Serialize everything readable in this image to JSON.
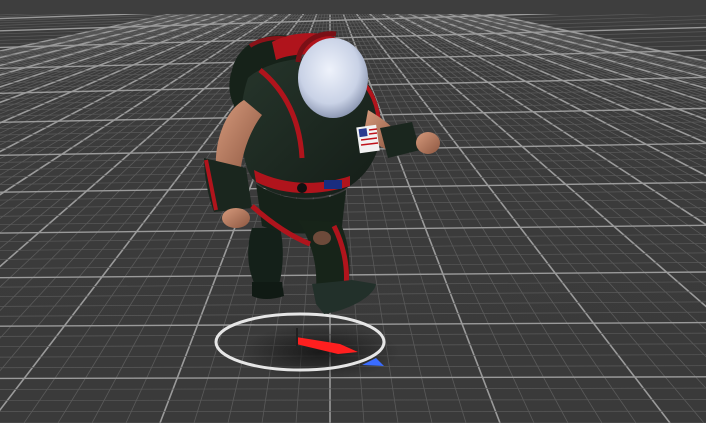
{
  "viewport": {
    "background": "#3a3a3a",
    "grid_minor_color": "#5a5a5a",
    "grid_major_color": "#9a9a9a"
  },
  "character": {
    "suit_color": "#1c2a20",
    "trim_color": "#b0141c",
    "helmet_color": "#c9d2e6",
    "skin_color": "#b87a5e",
    "patch": "us-flag-patch"
  },
  "gizmo": {
    "ring_color": "#e6e6e6",
    "forward_arrow_color": "#ff1f1f",
    "side_arrow_color": "#3a6cff"
  }
}
